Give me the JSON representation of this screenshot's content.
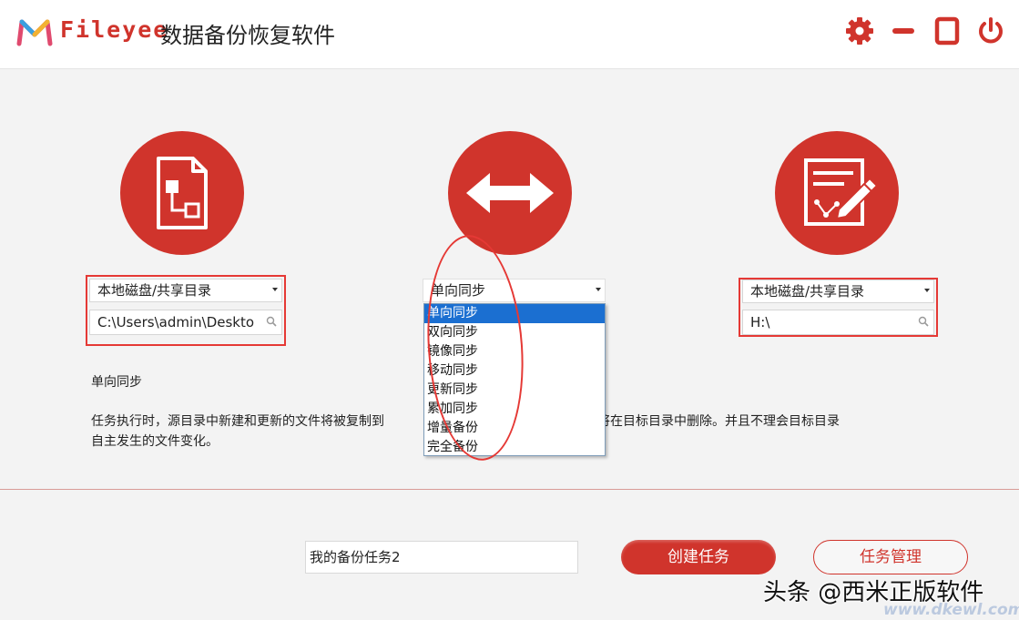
{
  "header": {
    "brand": "Fileyee",
    "title": "数据备份恢复软件",
    "settings_icon": "gear-icon",
    "minimize_icon": "minus-icon",
    "maximize_icon": "square-icon",
    "close_icon": "power-icon"
  },
  "source": {
    "icon": "document-structure-icon",
    "type_select": "本地磁盘/共享目录",
    "path": "C:\\Users\\admin\\Deskto"
  },
  "mode": {
    "icon": "double-arrow-icon",
    "selected": "单向同步",
    "options": [
      "单向同步",
      "双向同步",
      "镜像同步",
      "移动同步",
      "更新同步",
      "累加同步",
      "增量备份",
      "完全备份"
    ]
  },
  "target": {
    "icon": "edit-document-icon",
    "type_select": "本地磁盘/共享目录",
    "path": "H:\\"
  },
  "description": {
    "title": "单向同步",
    "text_left": "任务执行时，源目录中新建和更新的文件将被复制到",
    "text_right": "的文件将在目标目录中删除。并且不理会目标目录",
    "text_line2": "自主发生的文件变化。"
  },
  "footer": {
    "task_name": "我的备份任务2",
    "create_label": "创建任务",
    "manage_label": "任务管理"
  },
  "watermark": {
    "caption": "头条 @西米正版软件",
    "url": "www.dkewl.com"
  },
  "colors": {
    "accent": "#d0342c",
    "annotation": "#e53935",
    "selection": "#1b6fd1"
  }
}
